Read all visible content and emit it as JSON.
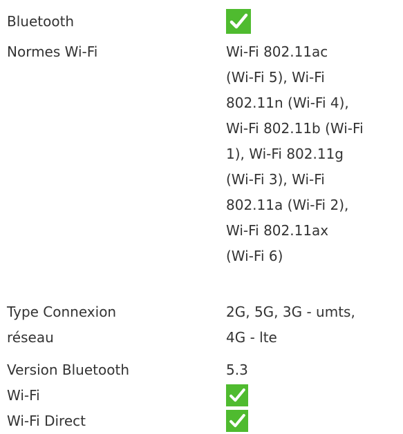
{
  "specs": {
    "bluetooth": {
      "label": "Bluetooth",
      "icon": "check-icon",
      "supported": true
    },
    "wifi_standards": {
      "label": "Normes Wi-Fi",
      "value_lines": [
        "Wi-Fi 802.11ac",
        "(Wi-Fi 5), Wi-Fi",
        "802.11n (Wi-Fi 4),",
        "Wi-Fi 802.11b (Wi-Fi",
        "1), Wi-Fi 802.11g",
        "(Wi-Fi 3), Wi-Fi",
        "802.11a (Wi-Fi 2),",
        "Wi-Fi 802.11ax",
        "(Wi-Fi 6)"
      ]
    },
    "network_type": {
      "label_lines": [
        "Type Connexion",
        "réseau"
      ],
      "value_lines": [
        "2G, 5G, 3G - umts,",
        "4G - lte"
      ]
    },
    "bluetooth_version": {
      "label": "Version Bluetooth",
      "value": "5.3"
    },
    "wifi": {
      "label": "Wi-Fi",
      "icon": "check-icon",
      "supported": true
    },
    "wifi_direct": {
      "label": "Wi-Fi Direct",
      "icon": "check-icon",
      "supported": true
    }
  },
  "colors": {
    "text": "#333333",
    "check_background": "#4fbb2f",
    "check_mark": "#ffffff"
  }
}
